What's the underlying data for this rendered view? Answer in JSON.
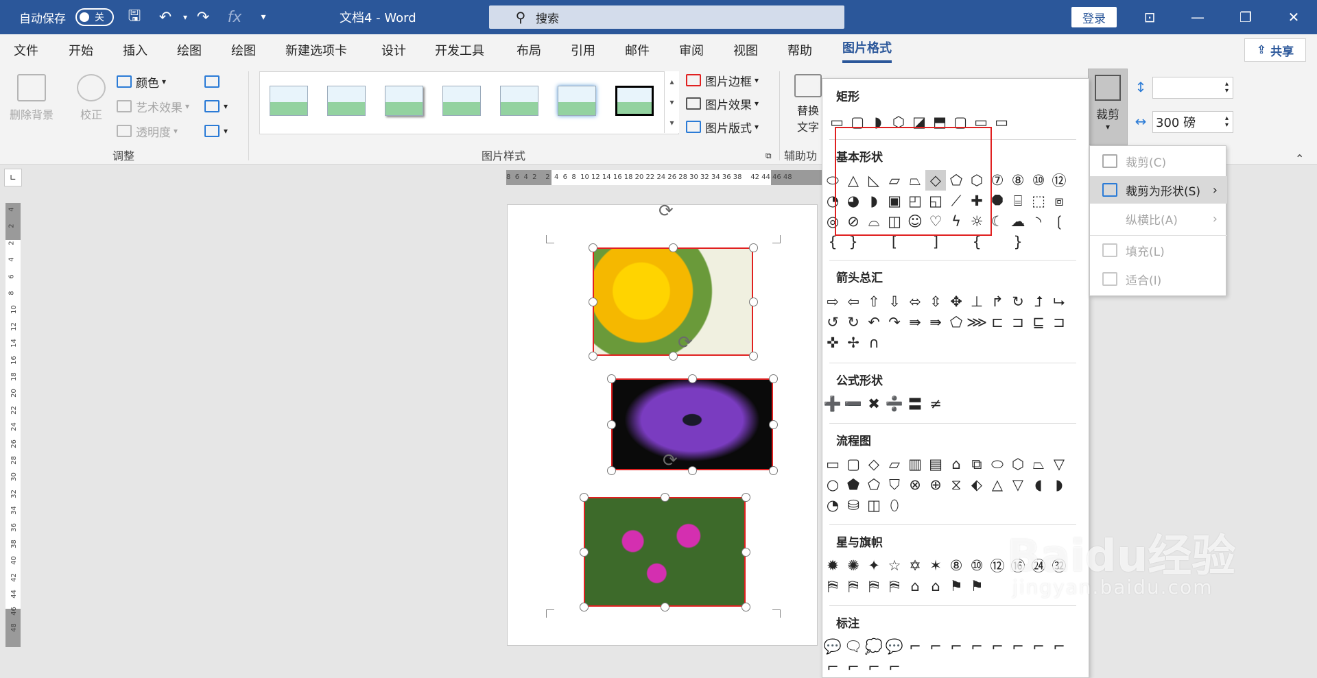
{
  "titlebar": {
    "autosave_label": "自动保存",
    "autosave_state": "关",
    "doc_title": "文档4  -  Word",
    "search_placeholder": "搜索",
    "login_label": "登录"
  },
  "tabs": [
    "文件",
    "开始",
    "插入",
    "绘图",
    "绘图",
    "新建选项卡",
    "设计",
    "开发工具",
    "布局",
    "引用",
    "邮件",
    "审阅",
    "视图",
    "帮助",
    "图片格式"
  ],
  "active_tab": "图片格式",
  "share_label": "共享",
  "ribbon": {
    "remove_bg": "删除背景",
    "correct": "校正",
    "color": "颜色",
    "art_effect": "艺术效果",
    "transparency": "透明度",
    "group_adjust": "调整",
    "group_styles": "图片样式",
    "border": "图片边框",
    "effect": "图片效果",
    "layout": "图片版式",
    "alt_text_1": "替换",
    "alt_text_2": "文字",
    "group_aux": "辅助功",
    "crop": "裁剪",
    "width_value": "300 磅"
  },
  "ruler_h_labels": "8  6  4  2    2  4  6  8  10 12 14 16 18 20 22 24 26 28 30 32 34 36 38    42 44 46 48",
  "ruler_v_labels": [
    "4",
    "2",
    "2",
    "4",
    "6",
    "8",
    "10",
    "12",
    "14",
    "16",
    "18",
    "20",
    "22",
    "24",
    "26",
    "28",
    "30",
    "32",
    "34",
    "36",
    "38",
    "40",
    "42",
    "44",
    "46",
    "48"
  ],
  "shapes_panel": {
    "sections": [
      {
        "title": "矩形",
        "rows": [
          "▭▢◗⬡◪⬒▢▭▭"
        ]
      },
      {
        "title": "基本形状",
        "rows": [
          "⬭△◺▱⏢◇⬠⬡⑦⑧⑩⑫",
          "◔◕◗▣◰◱⟋✚⯃⌸⬚⧈",
          "◎⊘⌓◫☺♡ϟ☼☾☁◝❲",
          "{} [ ] { }"
        ]
      },
      {
        "title": "箭头总汇",
        "rows": [
          "⇨⇦⇧⇩⬄⇳✥⊥↱↻⮥⮡",
          "↺↻↶↷⇛⇛⬠⋙⊏⊐⊑⊐",
          "✜✢∩"
        ]
      },
      {
        "title": "公式形状",
        "rows": [
          "➕➖✖➗〓≠"
        ]
      },
      {
        "title": "流程图",
        "rows": [
          "▭▢◇▱▥▤⌂⧉⬭⬡⏢▽",
          "○⬟⬠⛉⊗⊕⧖⬖△▽◖◗",
          "◔⛁◫⬯"
        ]
      },
      {
        "title": "星与旗帜",
        "rows": [
          "✹✺✦☆✡✶⑧⑩⑫⑯㉔㉜",
          "⛿⛿⛿⛿⌂⌂⚑⚑"
        ]
      },
      {
        "title": "标注",
        "rows": [
          "💬🗨💭💬⌐⌐⌐⌐⌐⌐⌐⌐",
          "⌐⌐⌐⌐"
        ]
      }
    ]
  },
  "crop_menu": {
    "items": [
      "裁剪(C)",
      "裁剪为形状(S)",
      "纵横比(A)",
      "填充(L)",
      "适合(I)"
    ],
    "active_index": 1
  },
  "watermark": {
    "brand": "Baidu经验",
    "url": "jingyan.baidu.com"
  },
  "colors": {
    "brand_blue": "#2b579a",
    "highlight_red": "#e02020"
  }
}
